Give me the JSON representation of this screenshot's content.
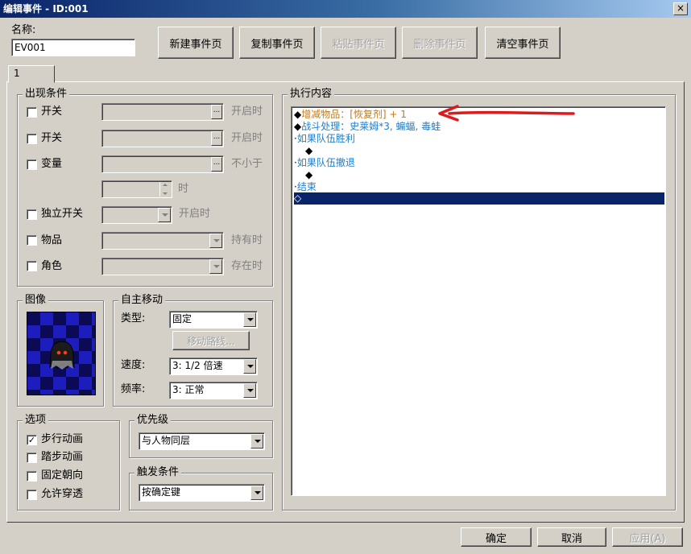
{
  "window": {
    "title": "编辑事件 - ID:001",
    "close_glyph": "×"
  },
  "name_label": "名称:",
  "name_value": "EV001",
  "toolbar": {
    "new_page": "新建事件页",
    "copy_page": "复制事件页",
    "paste_page": "粘贴事件页",
    "delete_page": "删除事件页",
    "clear_page": "清空事件页"
  },
  "tab_label": "1",
  "conditions": {
    "title": "出现条件",
    "switch1": {
      "label": "开关",
      "suffix": "开启时"
    },
    "switch2": {
      "label": "开关",
      "suffix": "开启时"
    },
    "variable": {
      "label": "变量",
      "suffix": "不小于"
    },
    "time_suffix": "时",
    "self_switch": {
      "label": "独立开关",
      "suffix": "开启时"
    },
    "item": {
      "label": "物品",
      "suffix": "持有时"
    },
    "actor": {
      "label": "角色",
      "suffix": "存在时"
    }
  },
  "graphic": {
    "title": "图像"
  },
  "autonomous": {
    "title": "自主移动",
    "type_label": "类型:",
    "type_value": "固定",
    "route_button": "移动路线...",
    "speed_label": "速度:",
    "speed_value": "3: 1/2 倍速",
    "freq_label": "频率:",
    "freq_value": "3: 正常"
  },
  "options": {
    "title": "选项",
    "walking_anim": {
      "label": "步行动画",
      "checked": true
    },
    "stepping_anim": {
      "label": "踏步动画",
      "checked": false
    },
    "direction_fix": {
      "label": "固定朝向",
      "checked": false
    },
    "through": {
      "label": "允许穿透",
      "checked": false
    }
  },
  "priority": {
    "title": "优先级",
    "value": "与人物同层"
  },
  "trigger": {
    "title": "触发条件",
    "value": "按确定键"
  },
  "contents": {
    "title": "执行内容",
    "lines": [
      {
        "prefix": "◆",
        "text": "增减物品：[恢复剂] + 1",
        "color": "#c67a10"
      },
      {
        "prefix": "◆",
        "text": "战斗处理：史莱姆*3, 蝙蝠, 毒蛙",
        "color": "#1f7ec9"
      },
      {
        "prefix": "·",
        "text": "如果队伍胜利",
        "color": "#1f7ec9"
      },
      {
        "prefix": "◆",
        "text": "",
        "color": "#000000"
      },
      {
        "prefix": "·",
        "text": "如果队伍撤退",
        "color": "#1f7ec9"
      },
      {
        "prefix": "◆",
        "text": "",
        "color": "#000000"
      },
      {
        "prefix": "·",
        "text": "结束",
        "color": "#1f7ec9"
      },
      {
        "prefix": "◇",
        "text": "",
        "color": "#ffffff",
        "selected": true
      }
    ]
  },
  "annotation_arrow_color": "#e0191a",
  "footer": {
    "ok": "确定",
    "cancel": "取消",
    "apply": "应用(A)"
  }
}
